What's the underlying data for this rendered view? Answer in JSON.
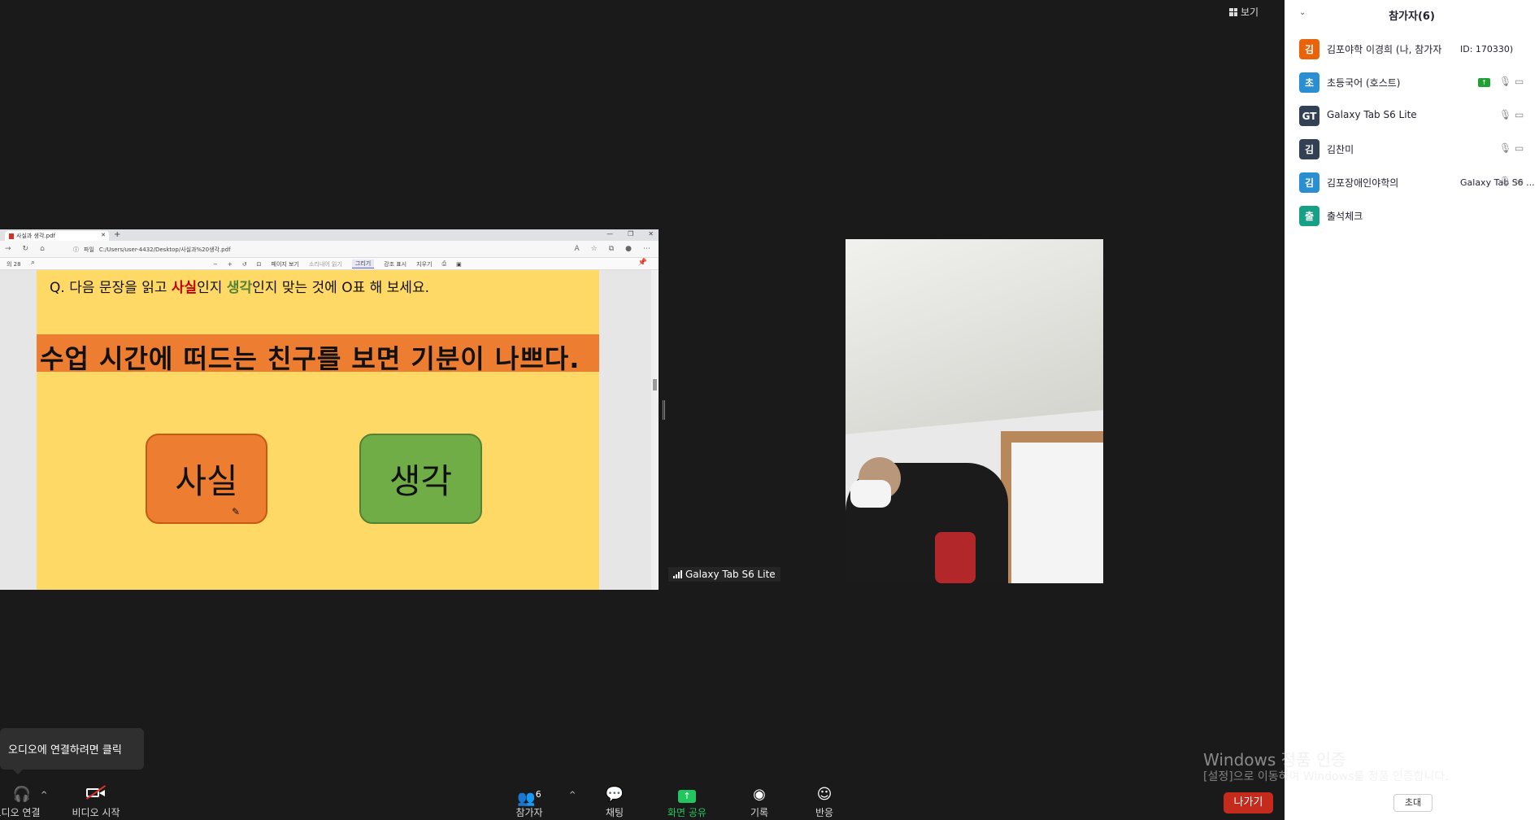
{
  "view_button": {
    "label": "보기"
  },
  "shared_screen": {
    "tab_title": "사실과 생각.pdf",
    "address_label": "파일",
    "address_url": "C:/Users/user-4432/Desktop/사실과%20생각.pdf",
    "page_label": "의 28",
    "toolbar": {
      "page_view": "페이지 보기",
      "read_aloud": "소리내어 읽기",
      "draw": "그리기",
      "highlight": "강조 표시",
      "erase": "지우기"
    },
    "slide": {
      "question_prefix": "Q. 다음 문장을 읽고 ",
      "fact_word": "사실",
      "question_mid": "인지 ",
      "opinion_word": "생각",
      "question_suffix": "인지 맞는 것에 O표 해 보세요.",
      "statement": "수업 시간에 떠드는 친구를 보면 기분이 나쁘다.",
      "fact_button": "사실",
      "opinion_button": "생각"
    }
  },
  "video": {
    "label": "Galaxy Tab S6 Lite"
  },
  "participants": {
    "title": "참가자(6)",
    "items": [
      {
        "initial": "김",
        "name": "김포야학 이경희 (나, 참가자",
        "sub": "ID: 170330)",
        "color": "#e8630a",
        "mic": false,
        "cam": false,
        "sharing": false
      },
      {
        "initial": "초",
        "name": "초등국어 (호스트)",
        "sub": "",
        "color": "#2a8fd1",
        "mic": true,
        "cam": true,
        "sharing": true
      },
      {
        "initial": "GT",
        "name": "Galaxy Tab S6 Lite",
        "sub": "",
        "color": "#334155",
        "mic": true,
        "cam": true,
        "sharing": false
      },
      {
        "initial": "김",
        "name": "김찬미",
        "sub": "",
        "color": "#334155",
        "mic": true,
        "cam": true,
        "sharing": false
      },
      {
        "initial": "김",
        "name": "김포장애인야학의",
        "sub": "Galaxy Tab S6 ...",
        "color": "#2a8fd1",
        "mic": true,
        "cam": true,
        "sharing": false
      },
      {
        "initial": "출",
        "name": "출석체크",
        "sub": "",
        "color": "#16a085",
        "mic": false,
        "cam": false,
        "sharing": false
      }
    ],
    "invite_label": "초대"
  },
  "watermark": {
    "line1": "Windows 정품 인증",
    "line2": "[설정]으로 이동하여 Windows를 정품 인증합니다."
  },
  "tooltip": {
    "text": "오디오에 연결하려면 클릭"
  },
  "toolbar": {
    "audio": "오디오 연결",
    "video": "비디오 시작",
    "participants": "참가자",
    "participants_count": "6",
    "chat": "채팅",
    "share": "화면 공유",
    "record": "기록",
    "reactions": "반응",
    "leave": "나가기",
    "share_color": "#22c55e",
    "leave_color": "#c42b1c"
  }
}
